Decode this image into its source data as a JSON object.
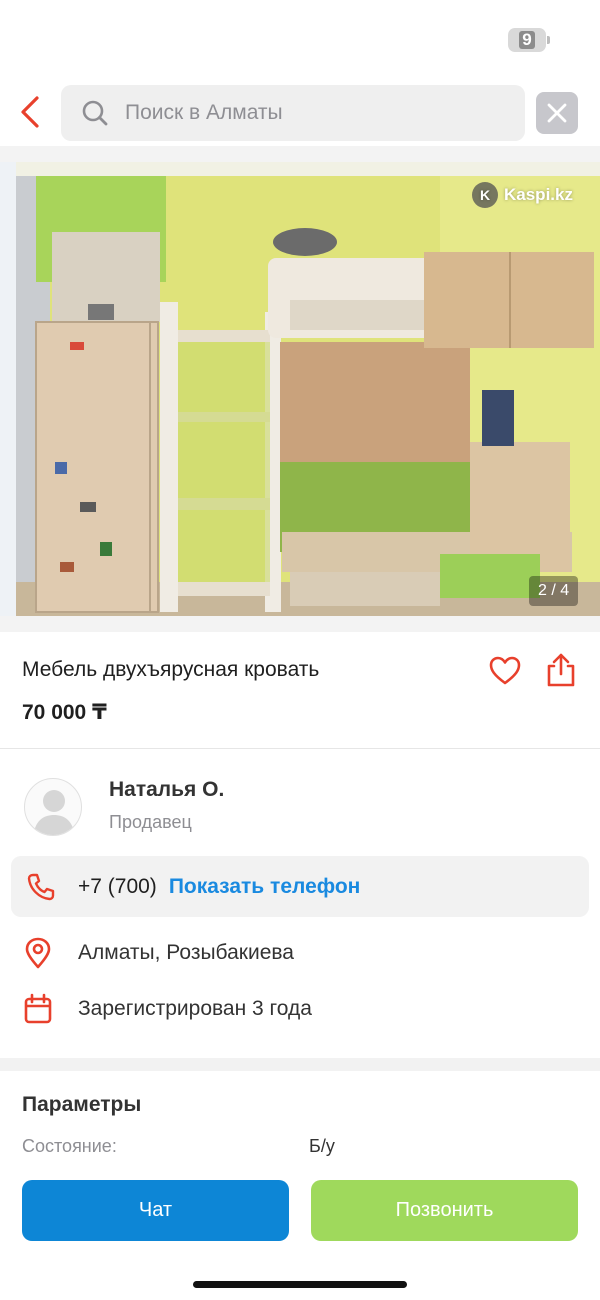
{
  "status_bar": {
    "battery": "9"
  },
  "header": {
    "search_placeholder": "Поиск в Алматы",
    "icons": {
      "back": "chevron-left-icon",
      "search": "search-icon",
      "close": "close-icon"
    }
  },
  "photo": {
    "watermark": "Kaspi.kz",
    "counter": "2 / 4",
    "description": "Двухъярусная кровать"
  },
  "listing": {
    "title": "Мебель двухъярусная кровать",
    "price": "70 000 ₸"
  },
  "seller": {
    "name": "Наталья О.",
    "role": "Продавец",
    "phone": "+7 (700)",
    "show_phone": "Показать телефон",
    "location": "Алматы, Розыбакиева",
    "registered": "Зарегистрирован 3 года"
  },
  "params": {
    "title": "Параметры",
    "items": [
      {
        "label": "Состояние:",
        "value": "Б/у"
      }
    ]
  },
  "actions": {
    "chat": "Чат",
    "call": "Позвонить"
  },
  "colors": {
    "accent_red": "#e8402c",
    "chat_blue": "#0d86d6",
    "call_green": "#9fd95c",
    "link_blue": "#1a8ae0"
  }
}
